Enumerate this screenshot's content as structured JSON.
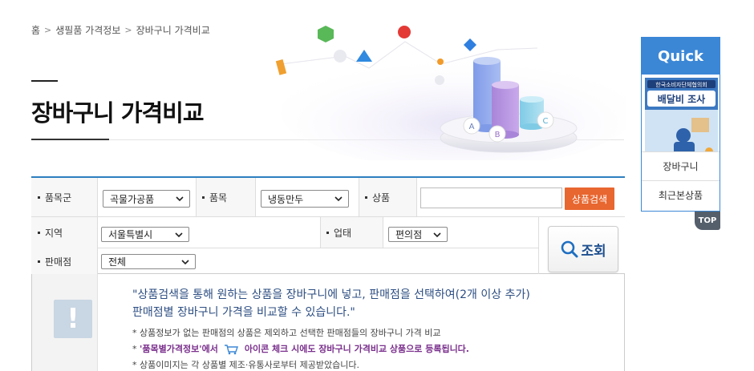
{
  "breadcrumb": [
    "홈",
    "생필품 가격정보",
    "장바구니 가격비교"
  ],
  "breadcrumb_sep": ">",
  "page_title": "장바구니 가격비교",
  "hero": {
    "labels": [
      "A",
      "B",
      "C"
    ]
  },
  "search": {
    "row1": {
      "category_label": "품목군",
      "category_value": "곡물가공품",
      "item_label": "품목",
      "item_value": "냉동만두",
      "product_label": "상품",
      "product_value": "",
      "search_button": "상품검색"
    },
    "row2": {
      "region_label": "지역",
      "region_value": "서울특별시",
      "biztype_label": "업태",
      "biztype_value": "편의점"
    },
    "row3": {
      "store_label": "판매점",
      "store_value": "전체"
    },
    "query_button": "조회"
  },
  "info": {
    "main_line1": "\"상품검색을 통해 원하는 상품을 장바구니에 넣고, 판매점을 선택하여(2개 이상 추가)",
    "main_line2": "판매점별 장바구니 가격을 비교할 수 있습니다.\"",
    "note1": "* 상품정보가 없는 판매점의 상품은 제외하고 선택한 판매점들의 장바구니 가격 비교",
    "note2_star": "*",
    "note2_link": "'품목별가격정보'에서",
    "note2_rest": "아이콘 체크 시에도 장바구니 가격비교 상품으로 등록됩니다.",
    "note3": "* 상품이미지는 각 상품별 제조·유통사로부터 제공받았습니다."
  },
  "quick": {
    "title": "Quick",
    "banner_top": "한국소비자단체협의회",
    "banner_main": "배달비 조사",
    "item1": "장바구니",
    "item2": "최근본상품",
    "top": "TOP"
  },
  "colors": {
    "accent_blue": "#3b87d6",
    "search_orange": "#e8662f",
    "border_top": "#2d7fc1"
  }
}
